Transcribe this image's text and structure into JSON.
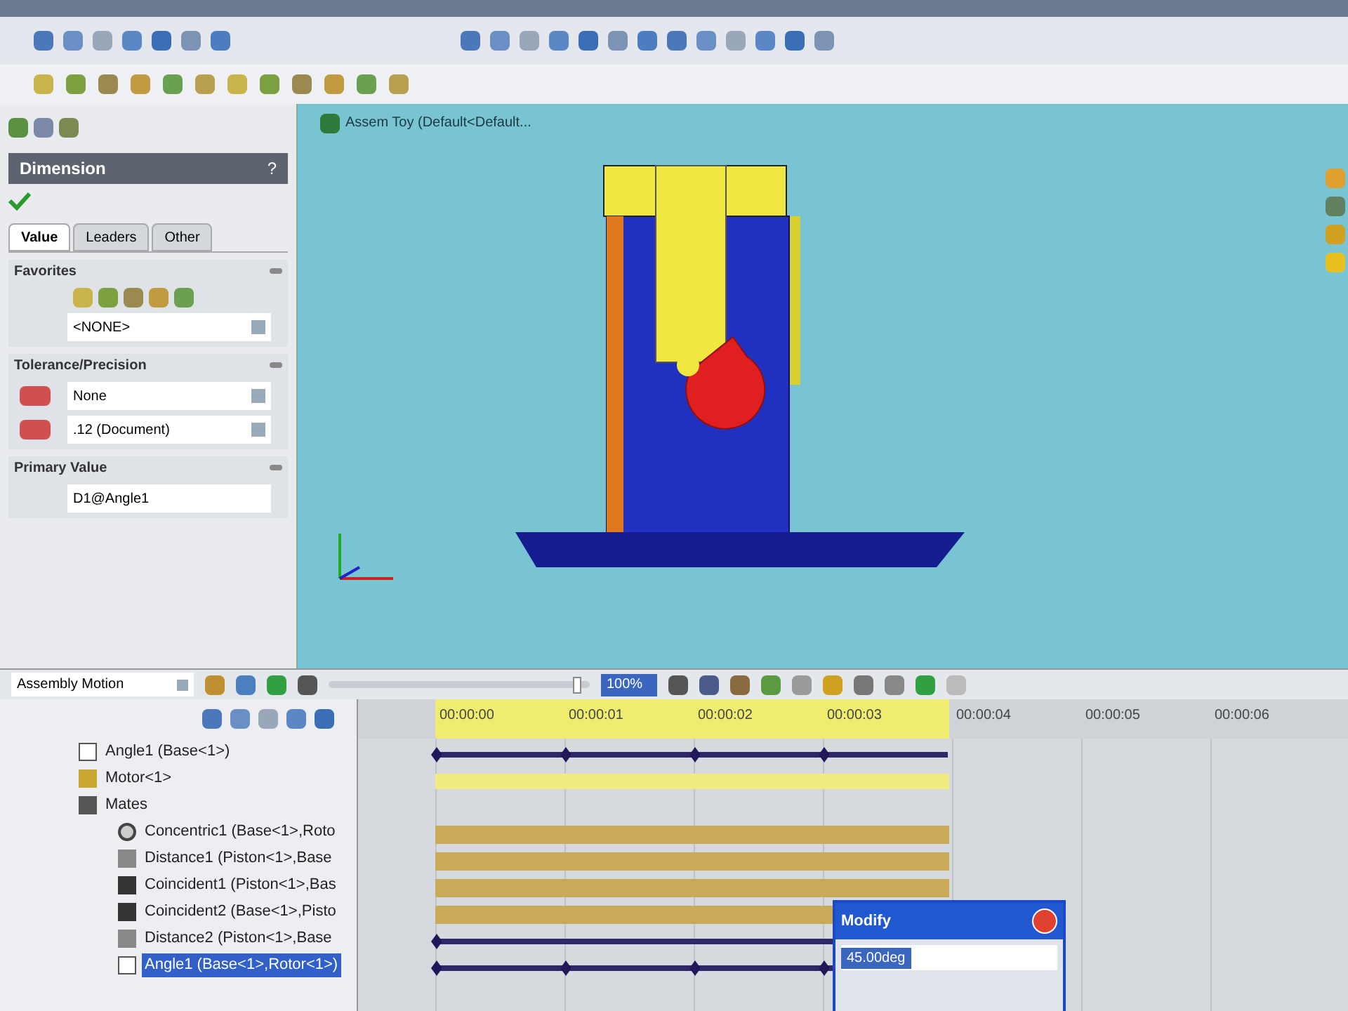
{
  "property_manager": {
    "title": "Dimension",
    "help": "?",
    "tabs": [
      {
        "label": "Value",
        "selected": true
      },
      {
        "label": "Leaders",
        "selected": false
      },
      {
        "label": "Other",
        "selected": false
      }
    ],
    "sections": [
      {
        "kind": "favorites",
        "title": "Favorites",
        "value": "<NONE>"
      },
      {
        "kind": "tolerance",
        "title": "Tolerance/Precision",
        "fields": [
          "None",
          ".12 (Document)"
        ]
      },
      {
        "kind": "primary",
        "title": "Primary Value",
        "value": "D1@Angle1"
      }
    ]
  },
  "viewport": {
    "breadcrumb": "Assem Toy  (Default<Default..."
  },
  "motion_manager": {
    "study_type": "Assembly Motion",
    "zoom": "100%",
    "playback_slider": {
      "level": 0.97
    },
    "tree": [
      {
        "label": "Angle1 (Base<1>)",
        "kind": "angle",
        "selected": false
      },
      {
        "label": "Motor<1>",
        "kind": "motor",
        "selected": false
      },
      {
        "label": "Mates",
        "kind": "folder",
        "selected": false,
        "children": [
          {
            "label": "Concentric1 (Base<1>,Roto",
            "kind": "concentric",
            "selected": false
          },
          {
            "label": "Distance1 (Piston<1>,Base",
            "kind": "distance",
            "selected": false
          },
          {
            "label": "Coincident1 (Piston<1>,Bas",
            "kind": "coincident",
            "selected": false
          },
          {
            "label": "Coincident2 (Base<1>,Pisto",
            "kind": "coincident",
            "selected": false
          },
          {
            "label": "Distance2 (Piston<1>,Base",
            "kind": "distance",
            "selected": false
          },
          {
            "label": "Angle1 (Base<1>,Rotor<1>)",
            "kind": "angle",
            "selected": true
          }
        ]
      }
    ],
    "times": [
      "00:00:00",
      "00:00:01",
      "00:00:02",
      "00:00:03",
      "00:00:04",
      "00:00:05",
      "00:00:06"
    ],
    "tracks": [
      {
        "kind": "keys"
      },
      {
        "kind": "highlight"
      },
      {
        "kind": "empty"
      },
      {
        "kind": "bar"
      },
      {
        "kind": "bar"
      },
      {
        "kind": "bar"
      },
      {
        "kind": "bar"
      },
      {
        "kind": "line"
      },
      {
        "kind": "keys"
      }
    ]
  },
  "modify_dialog": {
    "title": "Modify",
    "value": "45.00deg"
  }
}
